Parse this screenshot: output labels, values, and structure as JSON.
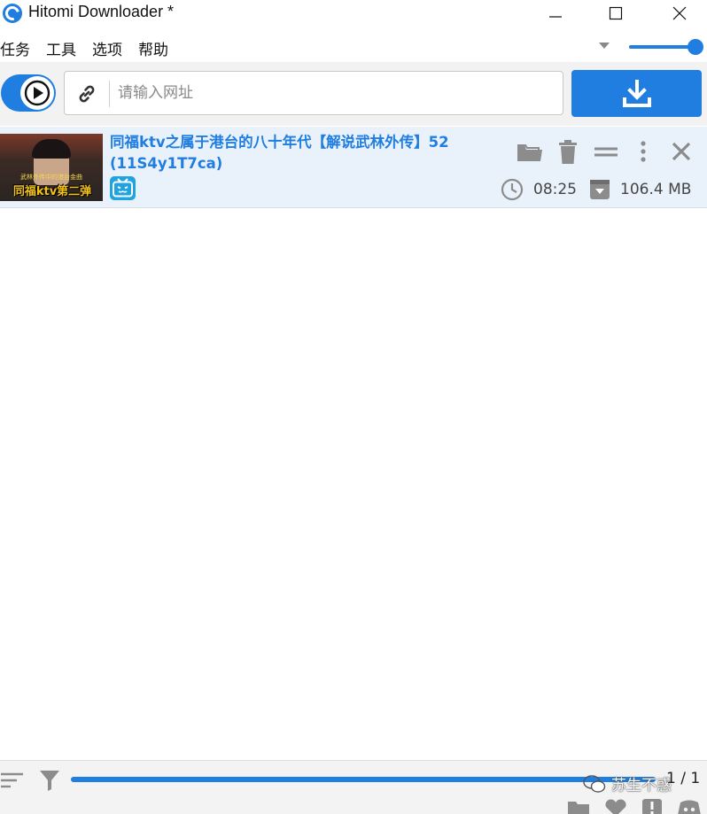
{
  "window": {
    "title": "Hitomi Downloader *"
  },
  "menu": {
    "items": [
      "任务",
      "工具",
      "选项",
      "帮助"
    ]
  },
  "volume": {
    "level": 1.0
  },
  "toolbar": {
    "url_placeholder": "请输入网址",
    "url_value": ""
  },
  "task": {
    "title": "同福ktv之属于港台的八十年代【解说武林外传】52 (11S4y1T7ca)",
    "thumbnail_text_small": "武林外传中的港台金曲",
    "thumbnail_text_big": "同福ktv第二弹",
    "duration": "08:25",
    "size": "106.4 MB",
    "source_icon": "bilibili-icon"
  },
  "status": {
    "progress": 1.0,
    "count": "1 / 1",
    "watermark": "苏生不惑"
  },
  "colors": {
    "accent": "#1f7ee0",
    "row_bg": "#e9f2fb",
    "bili": "#20a3e0"
  }
}
